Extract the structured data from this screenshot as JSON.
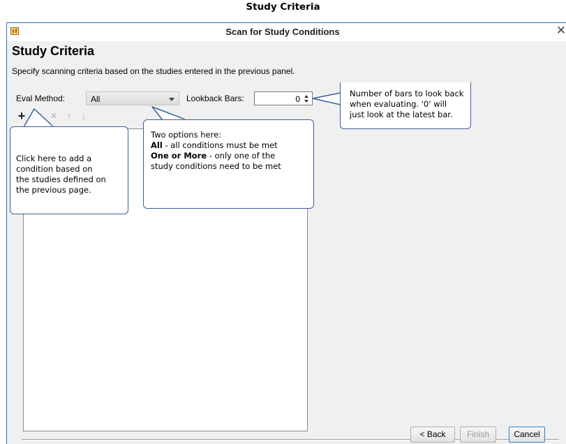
{
  "caption": "Study Criteria",
  "window": {
    "title": "Scan for Study Conditions",
    "close_glyph": "✕"
  },
  "panel": {
    "heading": "Study Criteria",
    "description": "Specify scanning criteria based on the studies entered in the previous panel."
  },
  "eval_method": {
    "label": "Eval Method:",
    "value": "All"
  },
  "lookback": {
    "label": "Lookback Bars:",
    "value": "0"
  },
  "toolbar": {
    "add_glyph": "+",
    "edit_glyph": "✎",
    "delete_glyph": "✕",
    "up_glyph": "↑",
    "down_glyph": "↓"
  },
  "buttons": {
    "back": "< Back",
    "finish": "Finish",
    "cancel": "Cancel"
  },
  "callouts": {
    "lookback": [
      "Number of bars to look back",
      "when evaluating.  '0' will",
      "just look at the latest bar."
    ],
    "eval": {
      "line1": "Two options here:",
      "all_bold": "All",
      "all_rest": " - all conditions must be met",
      "one_bold": "One or More",
      "one_rest": " - only one of the",
      "line4": "study conditions need to be met"
    },
    "add": [
      "Click here to add a",
      "condition based on",
      "the studies defined on",
      "the previous page."
    ]
  },
  "colors": {
    "accent": "#2b74c8",
    "callout_border": "#3b5f9a",
    "edit_icon": "#e8c24a"
  }
}
